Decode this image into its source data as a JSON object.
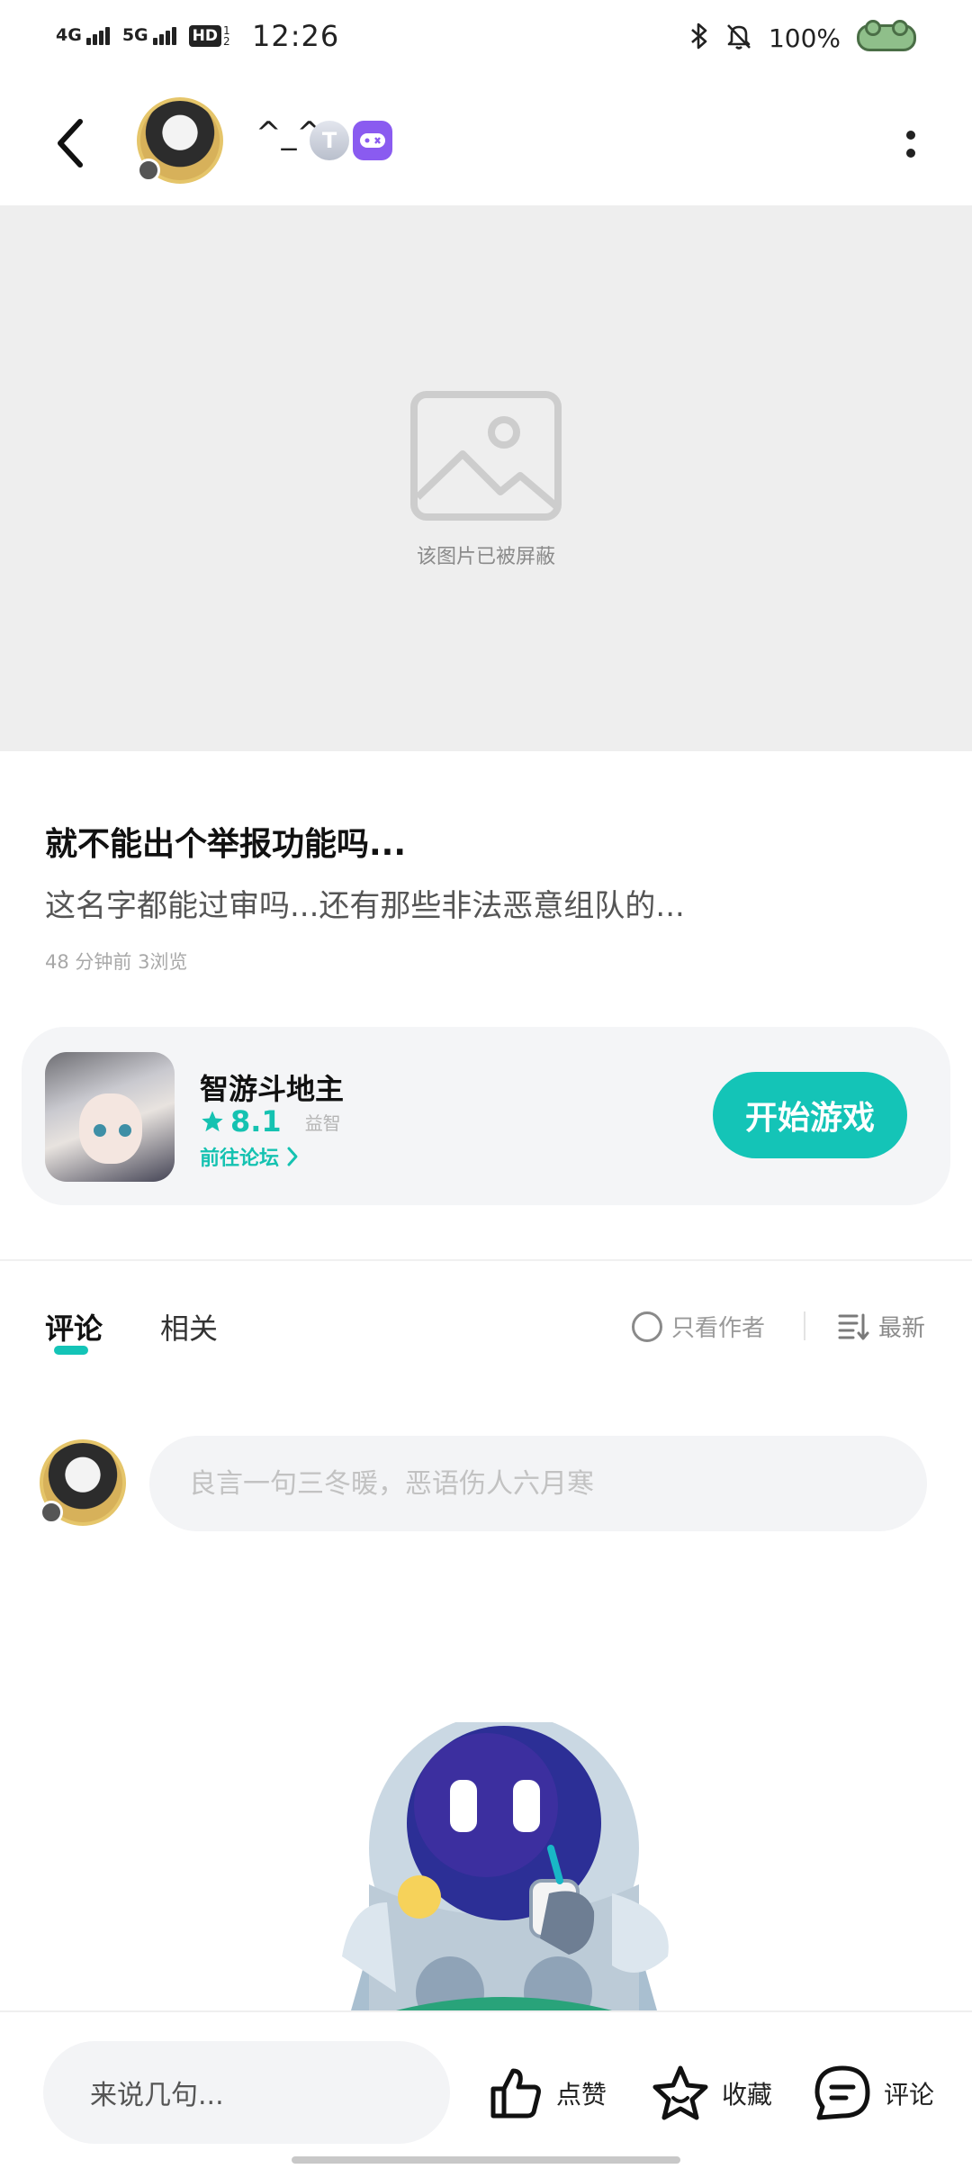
{
  "status_bar": {
    "signal1_label": "4G",
    "signal2_label": "5G",
    "hd_label": "HD",
    "hd_sub": "1 2",
    "time": "12:26",
    "battery_percent": "100%",
    "icons": [
      "bluetooth-icon",
      "bell-off-icon",
      "battery-icon"
    ]
  },
  "header": {
    "username": "^_^",
    "badge_label": "T",
    "icons": [
      "back-icon",
      "game-badge-icon",
      "more-icon"
    ]
  },
  "blocked_image": {
    "message": "该图片已被屏蔽"
  },
  "post": {
    "title": "就不能出个举报功能吗...",
    "body": "这名字都能过审吗...还有那些非法恶意组队的...",
    "meta": "48 分钟前  3浏览"
  },
  "game_card": {
    "name": "智游斗地主",
    "rating": "8.1",
    "genre": "益智",
    "forum_link": "前往论坛",
    "play_button": "开始游戏",
    "accent_color": "#14c4b7"
  },
  "comments_section": {
    "tabs": [
      "评论",
      "相关"
    ],
    "author_only": "只看作者",
    "sort": "最新",
    "input_placeholder": "良言一句三冬暖，恶语伤人六月寒"
  },
  "bottom_bar": {
    "reply_placeholder": "来说几句...",
    "like_label": "点赞",
    "favorite_label": "收藏",
    "comment_label": "评论"
  }
}
